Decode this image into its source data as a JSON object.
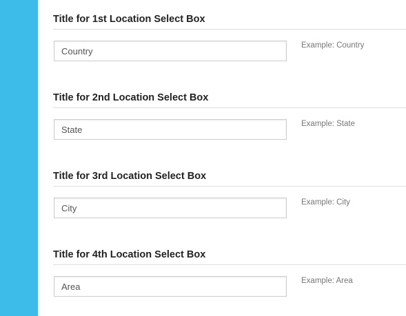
{
  "colors": {
    "sidebar": "#3dbbe9",
    "title_text": "#222222",
    "hint_text": "#777777",
    "divider": "#dddddd",
    "input_border": "#cccccc"
  },
  "sections": [
    {
      "title": "Title for 1st Location Select Box",
      "input_value": "Country",
      "hint": "Example: Country"
    },
    {
      "title": "Title for 2nd Location Select Box",
      "input_value": "State",
      "hint": "Example: State"
    },
    {
      "title": "Title for 3rd Location Select Box",
      "input_value": "City",
      "hint": "Example: City"
    },
    {
      "title": "Title for 4th Location Select Box",
      "input_value": "Area",
      "hint": "Example: Area"
    }
  ]
}
